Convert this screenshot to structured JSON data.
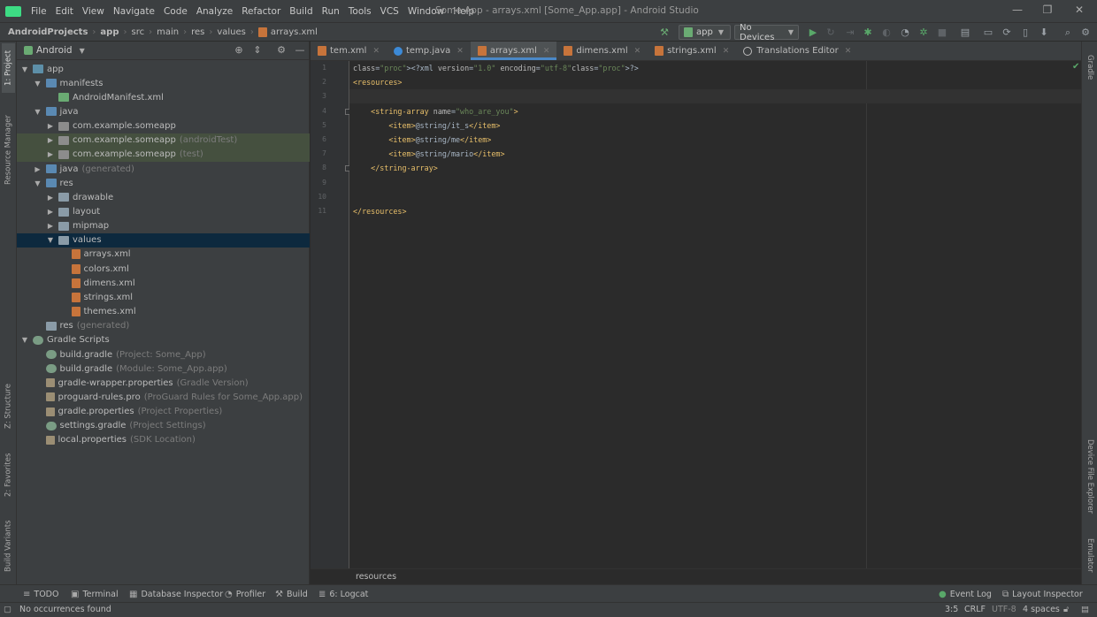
{
  "menubar": {
    "items": [
      "File",
      "Edit",
      "View",
      "Navigate",
      "Code",
      "Analyze",
      "Refactor",
      "Build",
      "Run",
      "Tools",
      "VCS",
      "Window",
      "Help"
    ],
    "window_title": "Some App - arrays.xml [Some_App.app] - Android Studio",
    "minimize": "—",
    "maximize": "❐",
    "close": "✕"
  },
  "navbar": {
    "crumbs": [
      "AndroidProjects",
      "app",
      "src",
      "main",
      "res",
      "values",
      "arrays.xml"
    ],
    "run_config": "app",
    "device": "No Devices"
  },
  "left_strip": {
    "project": "1: Project",
    "resource_manager": "Resource Manager",
    "structure": "Z: Structure",
    "favorites": "2: Favorites",
    "build_variants": "Build Variants"
  },
  "right_strip": {
    "gradle": "Gradle",
    "device_file_explorer": "Device File Explorer",
    "emulator": "Emulator"
  },
  "project_panel": {
    "view_mode": "Android",
    "tree": [
      {
        "label": "app",
        "hint": "",
        "depth": 0,
        "expanded": true,
        "icon": "module"
      },
      {
        "label": "manifests",
        "hint": "",
        "depth": 1,
        "expanded": true,
        "icon": "folder-blue"
      },
      {
        "label": "AndroidManifest.xml",
        "hint": "",
        "depth": 2,
        "icon": "manifest"
      },
      {
        "label": "java",
        "hint": "",
        "depth": 1,
        "expanded": true,
        "icon": "folder-blue"
      },
      {
        "label": "com.example.someapp",
        "hint": "",
        "depth": 2,
        "expanded": false,
        "icon": "pkg"
      },
      {
        "label": "com.example.someapp",
        "hint": "(androidTest)",
        "depth": 2,
        "expanded": false,
        "icon": "pkg"
      },
      {
        "label": "com.example.someapp",
        "hint": "(test)",
        "depth": 2,
        "expanded": false,
        "icon": "pkg"
      },
      {
        "label": "java",
        "hint": "(generated)",
        "depth": 1,
        "expanded": false,
        "icon": "folder-blue"
      },
      {
        "label": "res",
        "hint": "",
        "depth": 1,
        "expanded": true,
        "icon": "folder-blue"
      },
      {
        "label": "drawable",
        "hint": "",
        "depth": 2,
        "expanded": false,
        "icon": "folder"
      },
      {
        "label": "layout",
        "hint": "",
        "depth": 2,
        "expanded": false,
        "icon": "folder"
      },
      {
        "label": "mipmap",
        "hint": "",
        "depth": 2,
        "expanded": false,
        "icon": "folder"
      },
      {
        "label": "values",
        "hint": "",
        "depth": 2,
        "expanded": true,
        "icon": "folder"
      },
      {
        "label": "arrays.xml",
        "hint": "",
        "depth": 3,
        "icon": "xml"
      },
      {
        "label": "colors.xml",
        "hint": "",
        "depth": 3,
        "icon": "xml"
      },
      {
        "label": "dimens.xml",
        "hint": "",
        "depth": 3,
        "icon": "xml"
      },
      {
        "label": "strings.xml",
        "hint": "",
        "depth": 3,
        "icon": "xml"
      },
      {
        "label": "themes.xml",
        "hint": "",
        "depth": 3,
        "icon": "xml"
      },
      {
        "label": "res",
        "hint": "(generated)",
        "depth": 1,
        "icon": "folder"
      },
      {
        "label": "Gradle Scripts",
        "hint": "",
        "depth": 0,
        "expanded": true,
        "icon": "gradle"
      },
      {
        "label": "build.gradle",
        "hint": "(Project: Some_App)",
        "depth": 1,
        "icon": "gradle"
      },
      {
        "label": "build.gradle",
        "hint": "(Module: Some_App.app)",
        "depth": 1,
        "icon": "gradle"
      },
      {
        "label": "gradle-wrapper.properties",
        "hint": "(Gradle Version)",
        "depth": 1,
        "icon": "props"
      },
      {
        "label": "proguard-rules.pro",
        "hint": "(ProGuard Rules for Some_App.app)",
        "depth": 1,
        "icon": "props"
      },
      {
        "label": "gradle.properties",
        "hint": "(Project Properties)",
        "depth": 1,
        "icon": "props"
      },
      {
        "label": "settings.gradle",
        "hint": "(Project Settings)",
        "depth": 1,
        "icon": "gradle"
      },
      {
        "label": "local.properties",
        "hint": "(SDK Location)",
        "depth": 1,
        "icon": "props"
      }
    ]
  },
  "tabs": [
    {
      "label": "tem.xml",
      "icon": "xml-icon",
      "active": false
    },
    {
      "label": "temp.java",
      "icon": "java-icon",
      "active": false
    },
    {
      "label": "arrays.xml",
      "icon": "xml-icon",
      "active": true
    },
    {
      "label": "dimens.xml",
      "icon": "xml-icon",
      "active": false
    },
    {
      "label": "strings.xml",
      "icon": "xml-icon",
      "active": false
    },
    {
      "label": "Translations Editor",
      "icon": "globe-icon",
      "active": false
    }
  ],
  "editor": {
    "line_numbers": [
      "1",
      "2",
      "3",
      "4",
      "5",
      "6",
      "7",
      "8",
      "9",
      "10",
      "11"
    ],
    "current_line": 3,
    "lines": [
      "<?xml version=\"1.0\" encoding=\"utf-8\"?>",
      "<resources>",
      "",
      "    <string-array name=\"who_are_you\">",
      "        <item>@string/it_s</item>",
      "        <item>@string/me</item>",
      "        <item>@string/mario</item>",
      "    </string-array>",
      "",
      "",
      "</resources>"
    ],
    "breadcrumb": "resources"
  },
  "bottom_tabs": {
    "todo": "TODO",
    "terminal": "Terminal",
    "database_inspector": "Database Inspector",
    "profiler": "Profiler",
    "build": "Build",
    "logcat": "6: Logcat",
    "event_log": "Event Log",
    "layout_inspector": "Layout Inspector"
  },
  "status": {
    "message": "No occurrences found",
    "position": "3:5",
    "line_sep": "CRLF",
    "encoding": "UTF-8",
    "indent": "4 spaces"
  },
  "colors": {
    "accent": "#4a88c7",
    "selection": "#0d293e",
    "xml_tag": "#e8bf6a",
    "xml_value": "#6a8759"
  }
}
